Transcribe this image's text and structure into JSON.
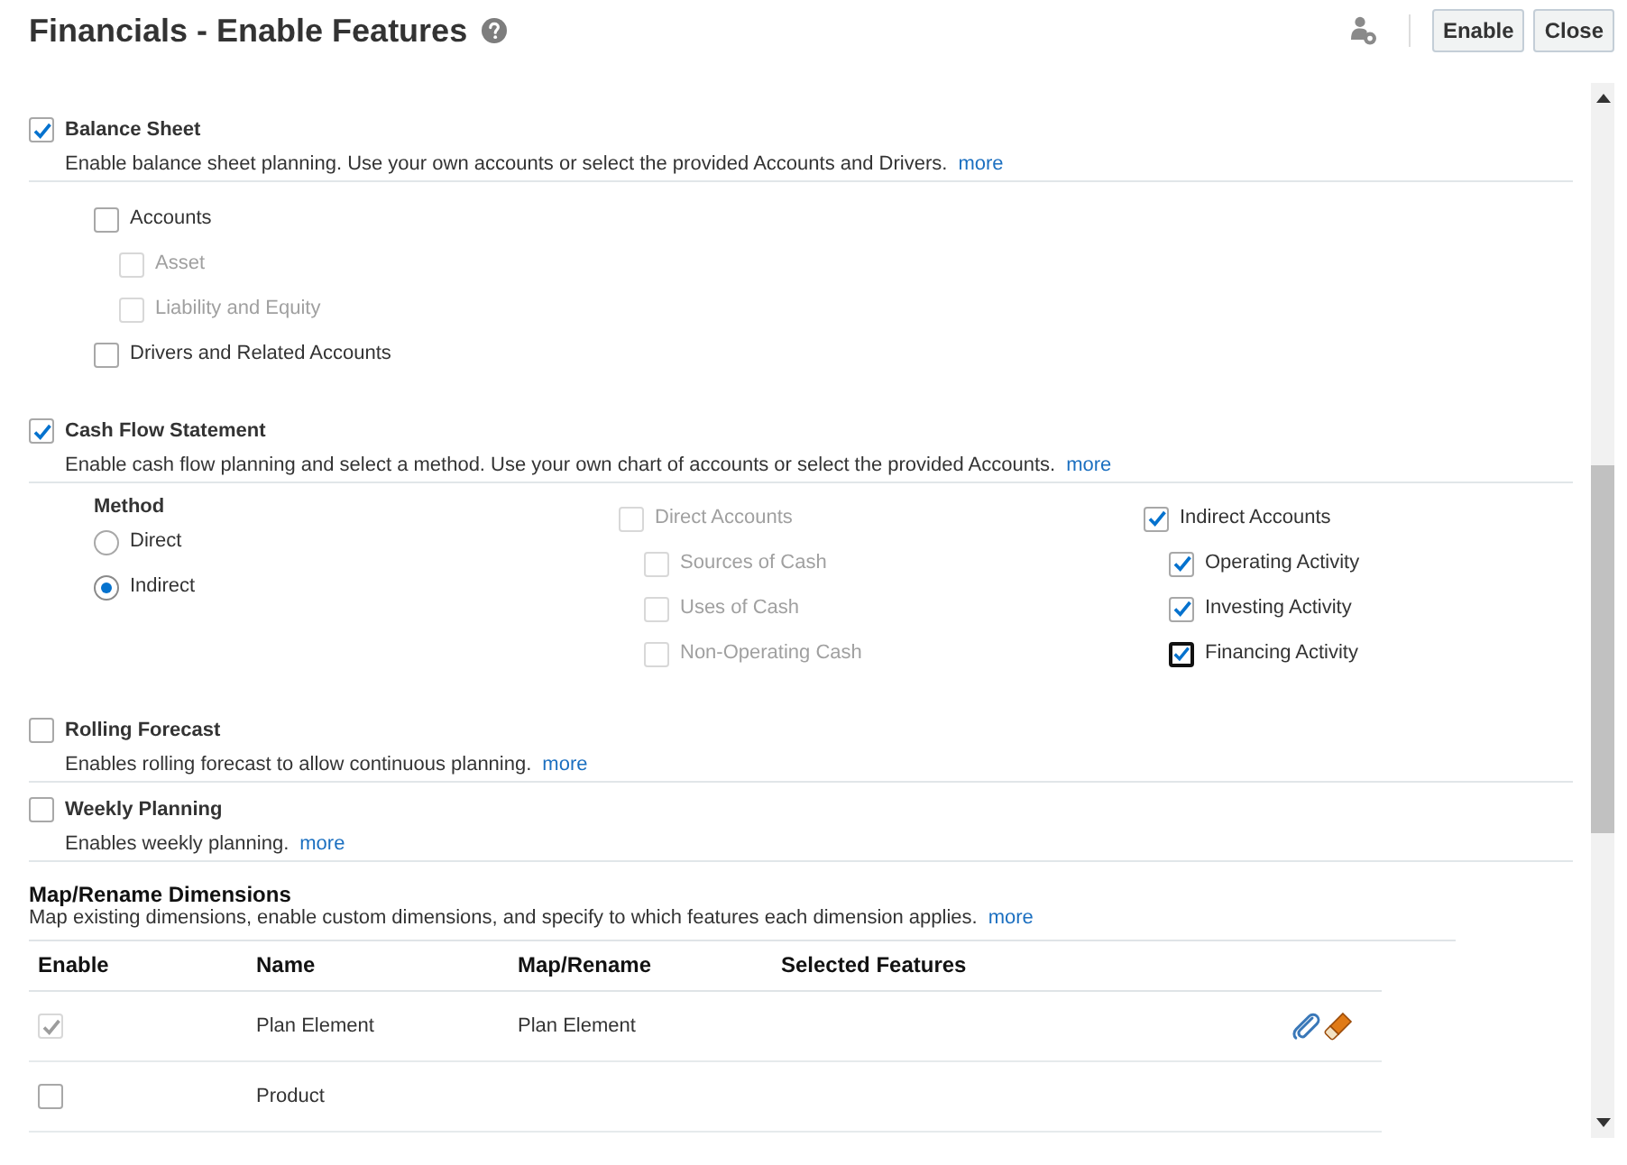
{
  "header": {
    "title": "Financials - Enable Features",
    "buttons": [
      {
        "label": "Enable"
      },
      {
        "label": "Close"
      }
    ]
  },
  "features": [
    {
      "kind": "tree",
      "label": "Balance Sheet",
      "checked": true,
      "description": "Enable balance sheet planning. Use your own accounts or select the provided Accounts and Drivers.",
      "link": "more",
      "options": [
        {
          "label": "Accounts",
          "checked": false,
          "disabled": false,
          "children": [
            {
              "label": "Asset",
              "checked": false,
              "disabled": true
            },
            {
              "label": "Liability and Equity",
              "checked": false,
              "disabled": true
            }
          ]
        },
        {
          "label": "Drivers and Related Accounts",
          "checked": false,
          "disabled": false
        }
      ]
    },
    {
      "kind": "method",
      "label": "Cash Flow Statement",
      "checked": true,
      "description": "Enable cash flow planning and select a method. Use your own chart of accounts or select the provided Accounts.",
      "link": "more",
      "method": {
        "label": "Method",
        "options": [
          {
            "label": "Direct",
            "selected": false
          },
          {
            "label": "Indirect",
            "selected": true
          }
        ]
      },
      "account_groups": [
        {
          "label": "Direct Accounts",
          "checked": false,
          "disabled": true,
          "children": [
            {
              "label": "Sources of Cash",
              "checked": false,
              "disabled": true,
              "focused": false
            },
            {
              "label": "Uses of Cash",
              "checked": false,
              "disabled": true,
              "focused": false
            },
            {
              "label": "Non-Operating Cash",
              "checked": false,
              "disabled": true,
              "focused": false
            }
          ]
        },
        {
          "label": "Indirect Accounts",
          "checked": true,
          "disabled": false,
          "children": [
            {
              "label": "Operating Activity",
              "checked": true,
              "disabled": false,
              "focused": false
            },
            {
              "label": "Investing Activity",
              "checked": true,
              "disabled": false,
              "focused": false
            },
            {
              "label": "Financing Activity",
              "checked": true,
              "disabled": false,
              "focused": true
            }
          ]
        }
      ]
    },
    {
      "kind": "plain",
      "label": "Rolling Forecast",
      "checked": false,
      "description": "Enables rolling forecast to allow continuous planning.",
      "link": "more"
    },
    {
      "kind": "plain",
      "label": "Weekly Planning",
      "checked": false,
      "description": "Enables weekly planning.",
      "link": "more"
    }
  ],
  "dimensions": {
    "title": "Map/Rename Dimensions",
    "description": "Map existing dimensions, enable custom dimensions, and specify to which features each dimension applies.",
    "link": "more",
    "columns": [
      "Enable",
      "Name",
      "Map/Rename",
      "Selected Features"
    ],
    "rows": [
      {
        "checked": true,
        "disabled": true,
        "name": "Plan Element",
        "map_rename": "Plan Element",
        "actions": true
      },
      {
        "checked": false,
        "disabled": false,
        "name": "Product",
        "actions": false
      }
    ]
  }
}
